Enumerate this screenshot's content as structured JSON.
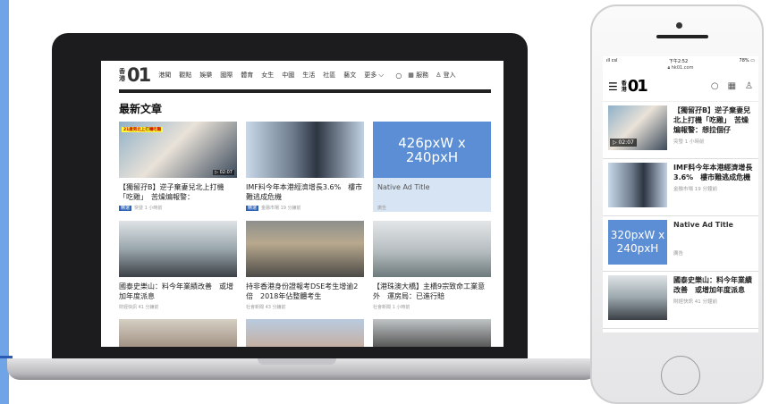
{
  "site": {
    "logo_small": "香港",
    "logo_big": "01",
    "nav": [
      "港聞",
      "觀點",
      "娛樂",
      "國際",
      "體育",
      "女生",
      "中國",
      "生活",
      "社區",
      "藝文",
      "更多"
    ],
    "service_label": "服務",
    "login_label": "登入",
    "section_title": "最新文章"
  },
  "desktop_cards": [
    {
      "title": "【獨留孖B】逆子棄妻兒北上打機「吃雞」　苦燥煸報警：",
      "tag": "精選",
      "meta": "突發 1 小時前",
      "duration": "02:07",
      "banner": "21歲男北上打機吃雞"
    },
    {
      "title": "IMF料今年本港經濟增長3.6%　樓市難逃成危機",
      "tag": "精選",
      "meta": "金融市場 19 分鐘前"
    },
    {
      "ad_size": "426pxW x 240pxH",
      "title": "Native Ad Title",
      "meta": "廣告"
    },
    {
      "title": "國泰史樂山：料今年業績改善　或增加年度派息",
      "meta": "財經快訊 41 分鐘前"
    },
    {
      "title": "持非香港身份證報考DSE考生增逾2倍　2018年佔整體考生",
      "meta": "社會新聞 43 分鐘前"
    },
    {
      "title": "【港珠澳大橋】主橋9宗致命工業意外　運房局：已進行賠",
      "meta": "社會新聞 1 小時前"
    }
  ],
  "phone": {
    "carrier": "csl",
    "time": "下午2:52",
    "battery": "78%",
    "url": "hk01.com",
    "items": [
      {
        "title": "【獨留孖B】逆子棄妻兒北上打機「吃雞」　苦燥煸報警：想拉個仔",
        "meta": "突發 1 小時前",
        "duration": "02:07"
      },
      {
        "title": "IMF料今年本港經濟增長3.6%　樓市難逃成危機",
        "meta": "金融市場 19 分鐘前"
      },
      {
        "ad_size_line1": "320pxW x",
        "ad_size_line2": "240pxH",
        "title": "Native Ad Title",
        "meta": "廣告"
      },
      {
        "title": "國泰史樂山：料今年業績改善　或增加年度派息",
        "meta": "財經快訊 41 分鐘前"
      }
    ]
  },
  "colors": {
    "ad_blue": "#5b8ed4",
    "ad_light": "#d7e4f3",
    "tag_blue": "#2f62b5"
  }
}
